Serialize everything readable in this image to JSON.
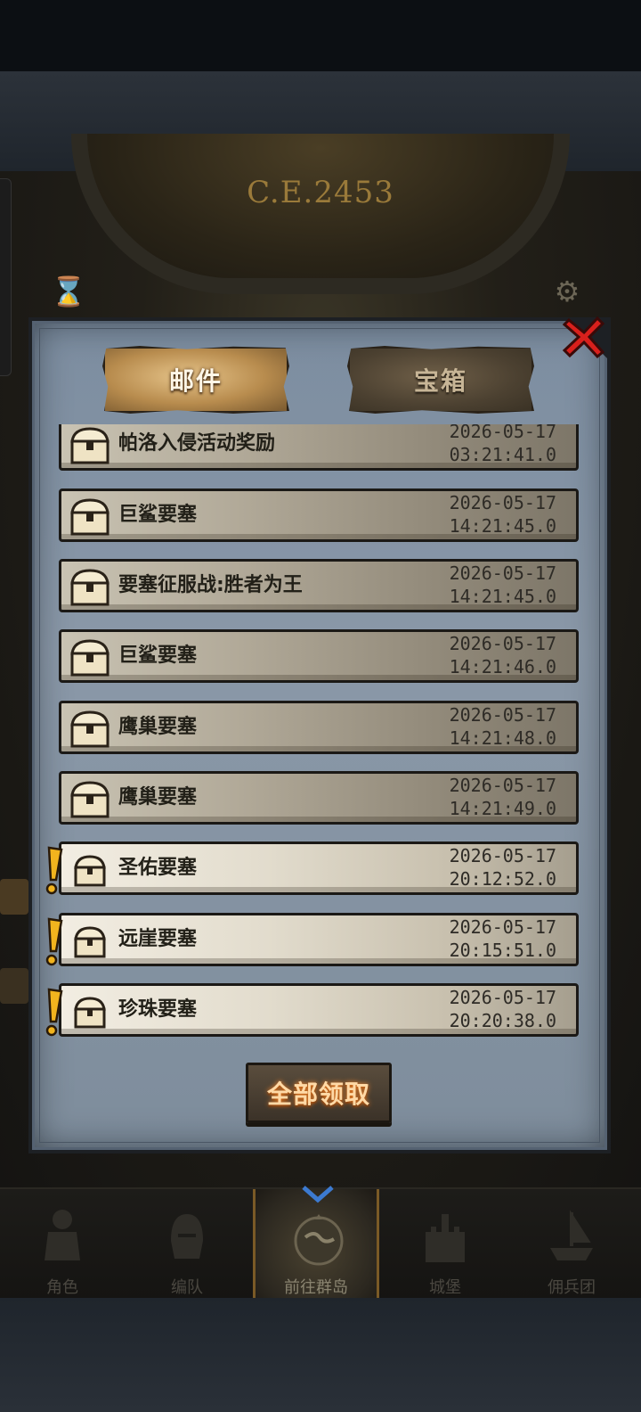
{
  "header": {
    "era_label": "C.E.2453"
  },
  "tabs": [
    {
      "label": "邮件",
      "active": true
    },
    {
      "label": "宝箱",
      "active": false
    }
  ],
  "mails": [
    {
      "title": "帕洛入侵活动奖励",
      "date": "2026-05-17",
      "time": "03:21:41.0",
      "unread": false
    },
    {
      "title": "巨鲨要塞",
      "date": "2026-05-17",
      "time": "14:21:45.0",
      "unread": false
    },
    {
      "title": "要塞征服战:胜者为王",
      "date": "2026-05-17",
      "time": "14:21:45.0",
      "unread": false
    },
    {
      "title": "巨鲨要塞",
      "date": "2026-05-17",
      "time": "14:21:46.0",
      "unread": false
    },
    {
      "title": "鹰巢要塞",
      "date": "2026-05-17",
      "time": "14:21:48.0",
      "unread": false
    },
    {
      "title": "鹰巢要塞",
      "date": "2026-05-17",
      "time": "14:21:49.0",
      "unread": false
    },
    {
      "title": "圣佑要塞",
      "date": "2026-05-17",
      "time": "20:12:52.0",
      "unread": true
    },
    {
      "title": "远崖要塞",
      "date": "2026-05-17",
      "time": "20:15:51.0",
      "unread": true
    },
    {
      "title": "珍珠要塞",
      "date": "2026-05-17",
      "time": "20:20:38.0",
      "unread": true
    }
  ],
  "claim_all_label": "全部领取",
  "bottom_nav": [
    {
      "label": "角色",
      "icon": "knight-icon",
      "active": false
    },
    {
      "label": "编队",
      "icon": "helmet-icon",
      "active": false
    },
    {
      "label": "前往群岛",
      "icon": "compass-globe-icon",
      "active": true
    },
    {
      "label": "城堡",
      "icon": "castle-icon",
      "active": false
    },
    {
      "label": "佣兵团",
      "icon": "ship-icon",
      "active": false
    }
  ],
  "colors": {
    "dialog_bg": "#8a98a8",
    "tab_active": "#c69a5c",
    "claim_text": "#ffd9a6",
    "alert": "#f2b41e",
    "close_red": "#d8201c"
  }
}
